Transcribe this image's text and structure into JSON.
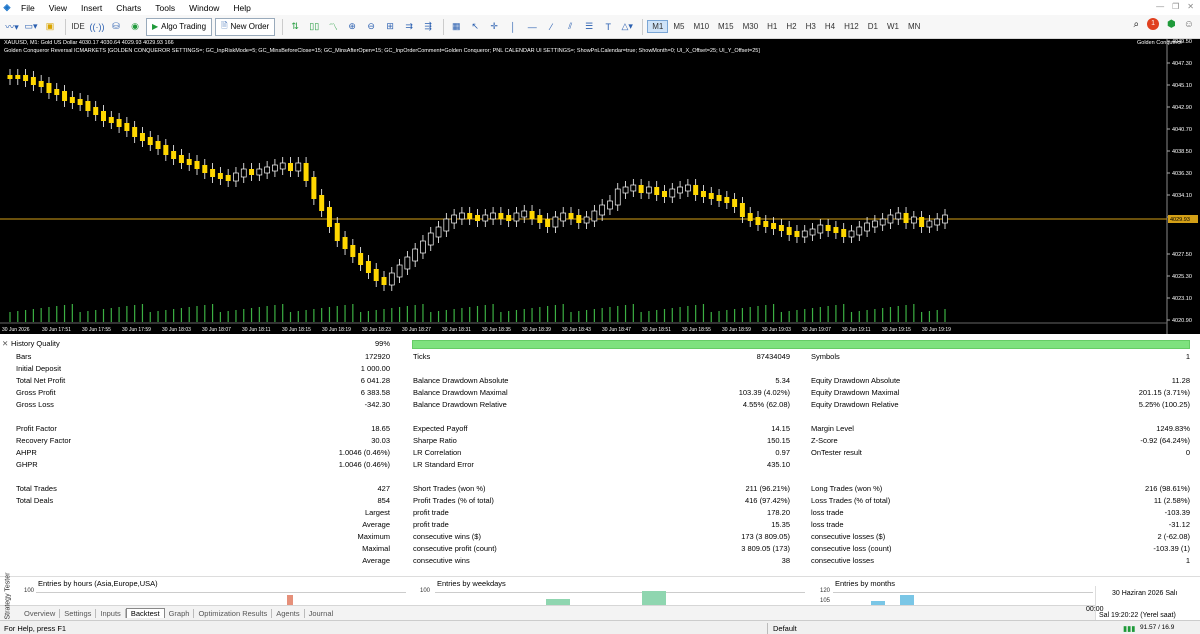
{
  "menu": [
    "File",
    "View",
    "Insert",
    "Charts",
    "Tools",
    "Window",
    "Help"
  ],
  "toolbar": {
    "ide": "IDE",
    "algo_trading": "Algo Trading",
    "new_order": "New Order",
    "timeframes": [
      "M1",
      "M5",
      "M10",
      "M15",
      "M30",
      "H1",
      "H2",
      "H3",
      "H4",
      "H12",
      "D1",
      "W1",
      "MN"
    ],
    "active_timeframe": "M1",
    "notifications": "1"
  },
  "chart": {
    "title": "XAUUSD, M1:  Gold US Dollar  4030.17 4030.64 4029.93 4029.93  166",
    "subtitle": "Golden Conqueror Reversal ICMARKETS [GOLDEN CONQUEROR SETTINGS=; GC_InpRiskMode=5; GC_MinsBeforeClose=15; GC_MinsAfterOpen=15; GC_InpOrderComment=Golden Conqueror; PNL CALENDAR UI SETTINGS=; ShowPnLCalendar=true; ShowMonth=0; UI_X_Offset=25; UI_Y_Offset=25]",
    "ea_label": "Golden Conqueror",
    "price_axis": [
      "4049.50",
      "4047.30",
      "4045.10",
      "4042.90",
      "4040.70",
      "4038.50",
      "4036.30",
      "4034.10",
      "4031.90",
      "4027.50",
      "4025.30",
      "4023.10",
      "4020.90"
    ],
    "current_price": "4029.93",
    "time_axis": [
      "30 Jun 2026",
      "30 Jun 17:51",
      "30 Jun 17:55",
      "30 Jun 17:59",
      "30 Jun 18:03",
      "30 Jun 18:07",
      "30 Jun 18:11",
      "30 Jun 18:15",
      "30 Jun 18:19",
      "30 Jun 18:23",
      "30 Jun 18:27",
      "30 Jun 18:31",
      "30 Jun 18:35",
      "30 Jun 18:39",
      "30 Jun 18:43",
      "30 Jun 18:47",
      "30 Jun 18:51",
      "30 Jun 18:55",
      "30 Jun 18:59",
      "30 Jun 19:03",
      "30 Jun 19:07",
      "30 Jun 19:11",
      "30 Jun 19:15",
      "30 Jun 19:19"
    ],
    "colors": {
      "bull": "#ffd700",
      "bear": "#ffd700",
      "wick": "#ffffff",
      "bg": "#000000",
      "price_line": "#d4a017",
      "volume": "#3cb043"
    }
  },
  "report": {
    "history_quality_label": "History Quality",
    "history_quality_value": "99%",
    "col1": [
      [
        "Bars",
        "172920"
      ],
      [
        "Initial Deposit",
        "1 000.00"
      ],
      [
        "Total Net Profit",
        "6 041.28"
      ],
      [
        "Gross Profit",
        "6 383.58"
      ],
      [
        "Gross Loss",
        "-342.30"
      ],
      [
        "",
        ""
      ],
      [
        "Profit Factor",
        "18.65"
      ],
      [
        "Recovery Factor",
        "30.03"
      ],
      [
        "AHPR",
        "1.0046 (0.46%)"
      ],
      [
        "GHPR",
        "1.0046 (0.46%)"
      ],
      [
        "",
        ""
      ],
      [
        "Total Trades",
        "427"
      ],
      [
        "Total Deals",
        "854"
      ],
      [
        "",
        "Largest"
      ],
      [
        "",
        "Average"
      ],
      [
        "",
        "Maximum"
      ],
      [
        "",
        "Maximal"
      ],
      [
        "",
        "Average"
      ]
    ],
    "col2": [
      [
        "Ticks",
        "87434049"
      ],
      [
        "",
        ""
      ],
      [
        "Balance Drawdown Absolute",
        "5.34"
      ],
      [
        "Balance Drawdown Maximal",
        "103.39 (4.02%)"
      ],
      [
        "Balance Drawdown Relative",
        "4.55% (62.08)"
      ],
      [
        "",
        ""
      ],
      [
        "Expected Payoff",
        "14.15"
      ],
      [
        "Sharpe Ratio",
        "150.15"
      ],
      [
        "LR Correlation",
        "0.97"
      ],
      [
        "LR Standard Error",
        "435.10"
      ],
      [
        "",
        ""
      ],
      [
        "Short Trades (won %)",
        "211 (96.21%)"
      ],
      [
        "Profit Trades (% of total)",
        "416 (97.42%)"
      ],
      [
        "profit trade",
        "178.20"
      ],
      [
        "profit trade",
        "15.35"
      ],
      [
        "consecutive wins ($)",
        "173 (3 809.05)"
      ],
      [
        "consecutive profit (count)",
        "3 809.05 (173)"
      ],
      [
        "consecutive wins",
        "38"
      ]
    ],
    "col3": [
      [
        "Symbols",
        "1"
      ],
      [
        "",
        ""
      ],
      [
        "Equity Drawdown Absolute",
        "11.28"
      ],
      [
        "Equity Drawdown Maximal",
        "201.15 (3.71%)"
      ],
      [
        "Equity Drawdown Relative",
        "5.25% (100.25)"
      ],
      [
        "",
        ""
      ],
      [
        "Margin Level",
        "1249.83%"
      ],
      [
        "Z-Score",
        "-0.92 (64.24%)"
      ],
      [
        "OnTester result",
        "0"
      ],
      [
        "",
        ""
      ],
      [
        "",
        ""
      ],
      [
        "Long Trades (won %)",
        "216 (98.61%)"
      ],
      [
        "Loss Trades (% of total)",
        "11 (2.58%)"
      ],
      [
        "loss trade",
        "-103.39"
      ],
      [
        "loss trade",
        "-31.12"
      ],
      [
        "consecutive losses ($)",
        "2 (-62.08)"
      ],
      [
        "consecutive loss (count)",
        "-103.39 (1)"
      ],
      [
        "consecutive losses",
        "1"
      ]
    ]
  },
  "histograms": {
    "hours_title": "Entries by hours (Asia,Europe,USA)",
    "weekdays_title": "Entries by weekdays",
    "months_title": "Entries by months",
    "hours_axis": "100",
    "weekdays_axis": "100",
    "months_axis_top": "120",
    "months_axis_mid": "105"
  },
  "tabs": [
    "Overview",
    "Settings",
    "Inputs",
    "Backtest",
    "Graph",
    "Optimization Results",
    "Agents",
    "Journal"
  ],
  "active_tab": "Backtest",
  "panel_label": "Strategy Tester",
  "status": {
    "help": "For Help, press F1",
    "profile": "Default",
    "date": "30 Haziran 2026 Salı",
    "time": "Sal 19:20:22 (Yerel saat)",
    "elapsed": "00:00",
    "net": "91.57 / 16.9"
  }
}
